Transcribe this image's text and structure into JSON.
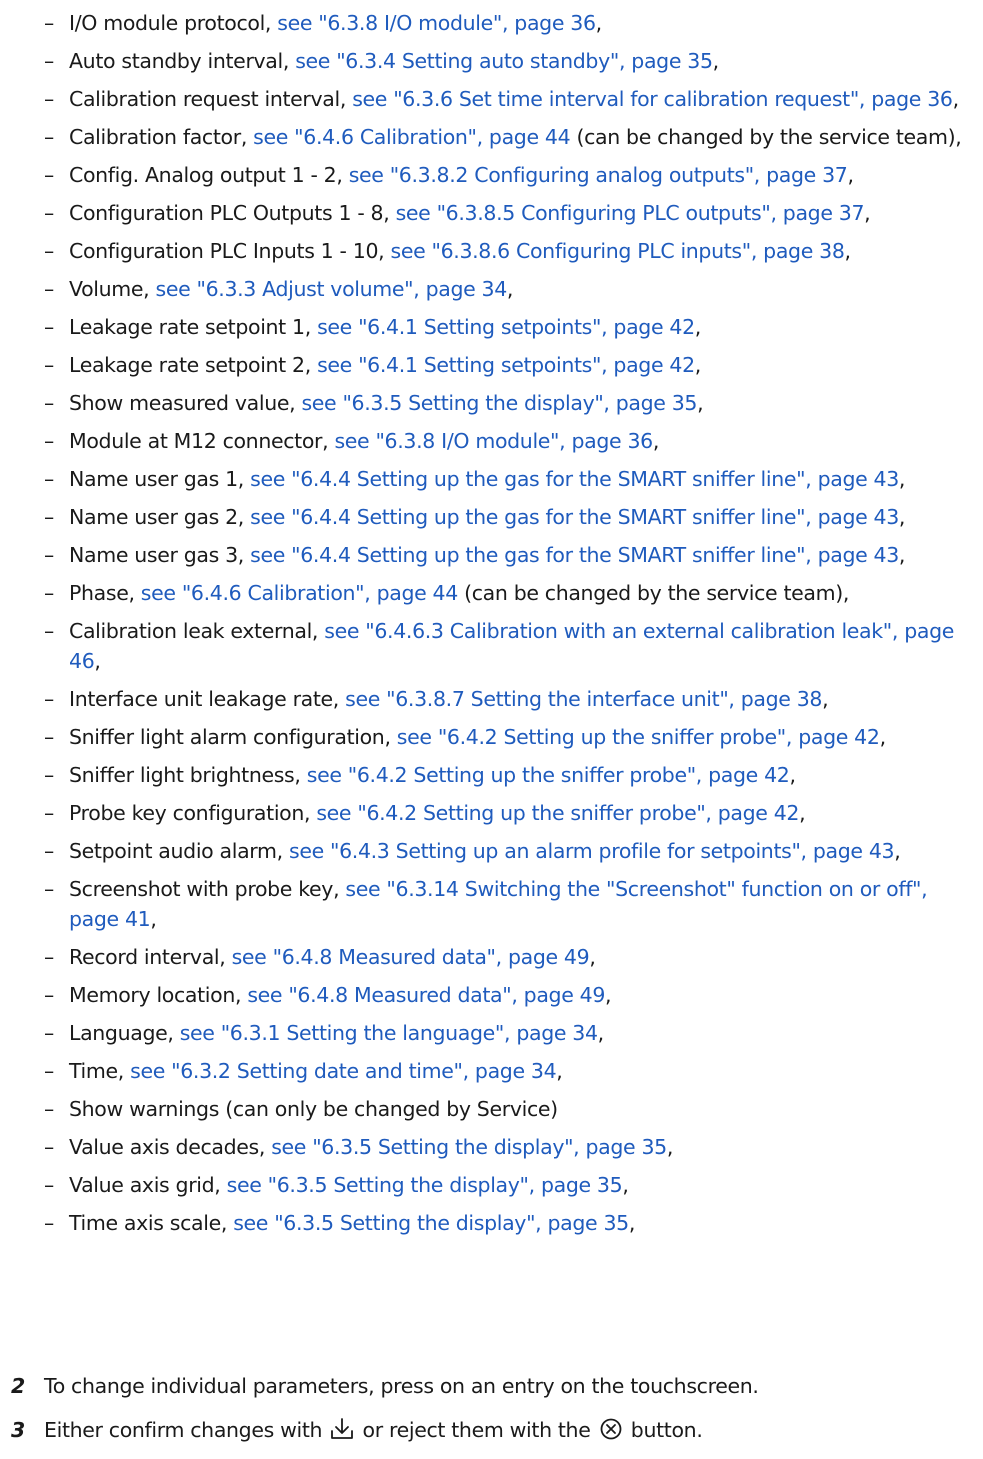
{
  "items": [
    {
      "label": "I/O module protocol, ",
      "link": "see \"6.3.8 I/O module\", page 36",
      "suffix": ","
    },
    {
      "label": "Auto standby interval, ",
      "link": "see \"6.3.4 Setting auto standby\", page 35",
      "suffix": ","
    },
    {
      "label": "Calibration request interval, ",
      "link": "see \"6.3.6 Set time interval for calibration request\", page 36",
      "suffix": ","
    },
    {
      "label": "Calibration factor, ",
      "link": "see \"6.4.6 Calibration\", page 44",
      "suffix": " (can be changed by the service team),"
    },
    {
      "label": "Config. Analog output 1 - 2, ",
      "link": "see \"6.3.8.2 Configuring analog outputs\", page 37",
      "suffix": ","
    },
    {
      "label": "Configuration PLC Outputs 1 - 8, ",
      "link": "see \"6.3.8.5 Configuring PLC outputs\", page 37",
      "suffix": ","
    },
    {
      "label": "Configuration PLC Inputs 1 - 10, ",
      "link": "see \"6.3.8.6 Configuring PLC inputs\", page 38",
      "suffix": ","
    },
    {
      "label": "Volume, ",
      "link": "see \"6.3.3 Adjust volume\", page 34",
      "suffix": ","
    },
    {
      "label": "Leakage rate setpoint 1, ",
      "link": "see \"6.4.1 Setting setpoints\", page 42",
      "suffix": ","
    },
    {
      "label": "Leakage rate setpoint 2, ",
      "link": "see \"6.4.1 Setting setpoints\", page 42",
      "suffix": ","
    },
    {
      "label": "Show measured value, ",
      "link": "see \"6.3.5 Setting the display\", page 35",
      "suffix": ","
    },
    {
      "label": "Module at M12 connector, ",
      "link": "see \"6.3.8 I/O module\", page 36",
      "suffix": ","
    },
    {
      "label": "Name user gas 1, ",
      "link": "see \"6.4.4 Setting up the gas for the SMART sniffer line\", page 43",
      "suffix": ","
    },
    {
      "label": "Name user gas 2, ",
      "link": "see \"6.4.4 Setting up the gas for the SMART sniffer line\", page 43",
      "suffix": ","
    },
    {
      "label": "Name user gas 3, ",
      "link": "see \"6.4.4 Setting up the gas for the SMART sniffer line\", page 43",
      "suffix": ","
    },
    {
      "label": "Phase, ",
      "link": "see \"6.4.6 Calibration\", page 44",
      "suffix": " (can be changed by the service team),"
    },
    {
      "label": "Calibration leak external, ",
      "link": "see \"6.4.6.3 Calibration with an external calibration leak\", page 46",
      "suffix": ","
    },
    {
      "label": "Interface unit leakage rate, ",
      "link": "see \"6.3.8.7 Setting the interface unit\", page 38",
      "suffix": ","
    },
    {
      "label": "Sniffer light alarm configuration, ",
      "link": "see \"6.4.2 Setting up the sniffer probe\", page 42",
      "suffix": ","
    },
    {
      "label": "Sniffer light brightness, ",
      "link": "see \"6.4.2 Setting up the sniffer probe\", page 42",
      "suffix": ","
    },
    {
      "label": "Probe key configuration, ",
      "link": "see \"6.4.2 Setting up the sniffer probe\", page 42",
      "suffix": ","
    },
    {
      "label": "Setpoint audio alarm, ",
      "link": "see \"6.4.3 Setting up an alarm profile for setpoints\", page 43",
      "suffix": ","
    },
    {
      "label": "Screenshot with probe key, ",
      "link": "see \"6.3.14 Switching the \"Screenshot\" function on or off\", page 41",
      "suffix": ","
    },
    {
      "label": "Record interval, ",
      "link": "see \"6.4.8 Measured data\", page 49",
      "suffix": ","
    },
    {
      "label": "Memory location, ",
      "link": "see \"6.4.8 Measured data\", page 49",
      "suffix": ","
    },
    {
      "label": "Language, ",
      "link": "see \"6.3.1 Setting the language\", page 34",
      "suffix": ","
    },
    {
      "label": "Time, ",
      "link": "see \"6.3.2 Setting date and time\", page 34",
      "suffix": ","
    },
    {
      "label": "Show warnings (can only be changed by Service)",
      "link": "",
      "suffix": ""
    },
    {
      "label": "Value axis decades, ",
      "link": "see \"6.3.5 Setting the display\", page 35",
      "suffix": ","
    },
    {
      "label": "Value axis grid, ",
      "link": "see \"6.3.5 Setting the display\", page 35",
      "suffix": ","
    },
    {
      "label": "Time axis scale, ",
      "link": "see \"6.3.5 Setting the display\", page 35",
      "suffix": ","
    }
  ],
  "dash": "–",
  "steps": [
    {
      "num": "2",
      "text": "To change individual parameters, press on an entry on the touchscreen."
    },
    {
      "num": "3",
      "text_before": "Either confirm changes with ",
      "icon_confirm": "confirm-download-icon",
      "text_middle": " or reject them with the ",
      "icon_reject": "reject-circle-x-icon",
      "text_after": " button."
    }
  ],
  "colors": {
    "link": "#1f5bbd",
    "text": "#1a1a1a"
  }
}
